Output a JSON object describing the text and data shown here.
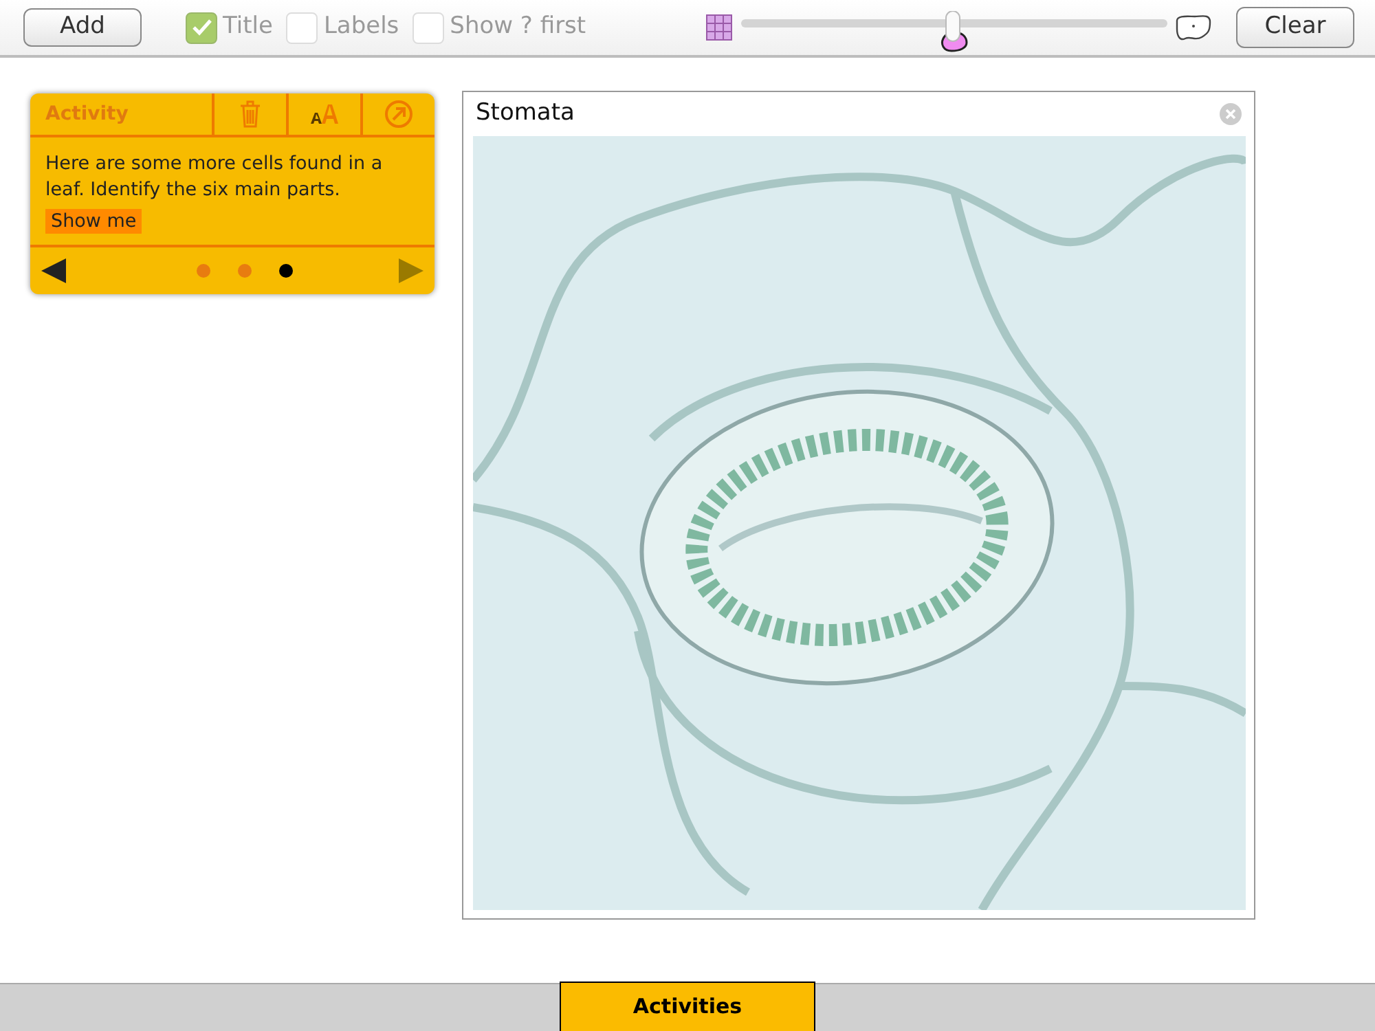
{
  "toolbar": {
    "add_button": "Add",
    "checkboxes": [
      {
        "label": "Title",
        "checked": true
      },
      {
        "label": "Labels",
        "checked": false
      },
      {
        "label": "Show ? first",
        "checked": false
      }
    ],
    "zoom_slider": {
      "level": 0.5
    },
    "clear_button": "Clear"
  },
  "activity_card": {
    "title": "Activity",
    "text": "Here are some more cells found in a leaf. Identify the six main parts.",
    "show_me": "Show me",
    "pages": [
      {
        "selected": false
      },
      {
        "selected": false
      },
      {
        "selected": true
      }
    ]
  },
  "image_panel": {
    "title": "Stomata"
  },
  "bottom_bar": {
    "tabs": [
      {
        "label": "Activities",
        "selected": true
      }
    ]
  }
}
